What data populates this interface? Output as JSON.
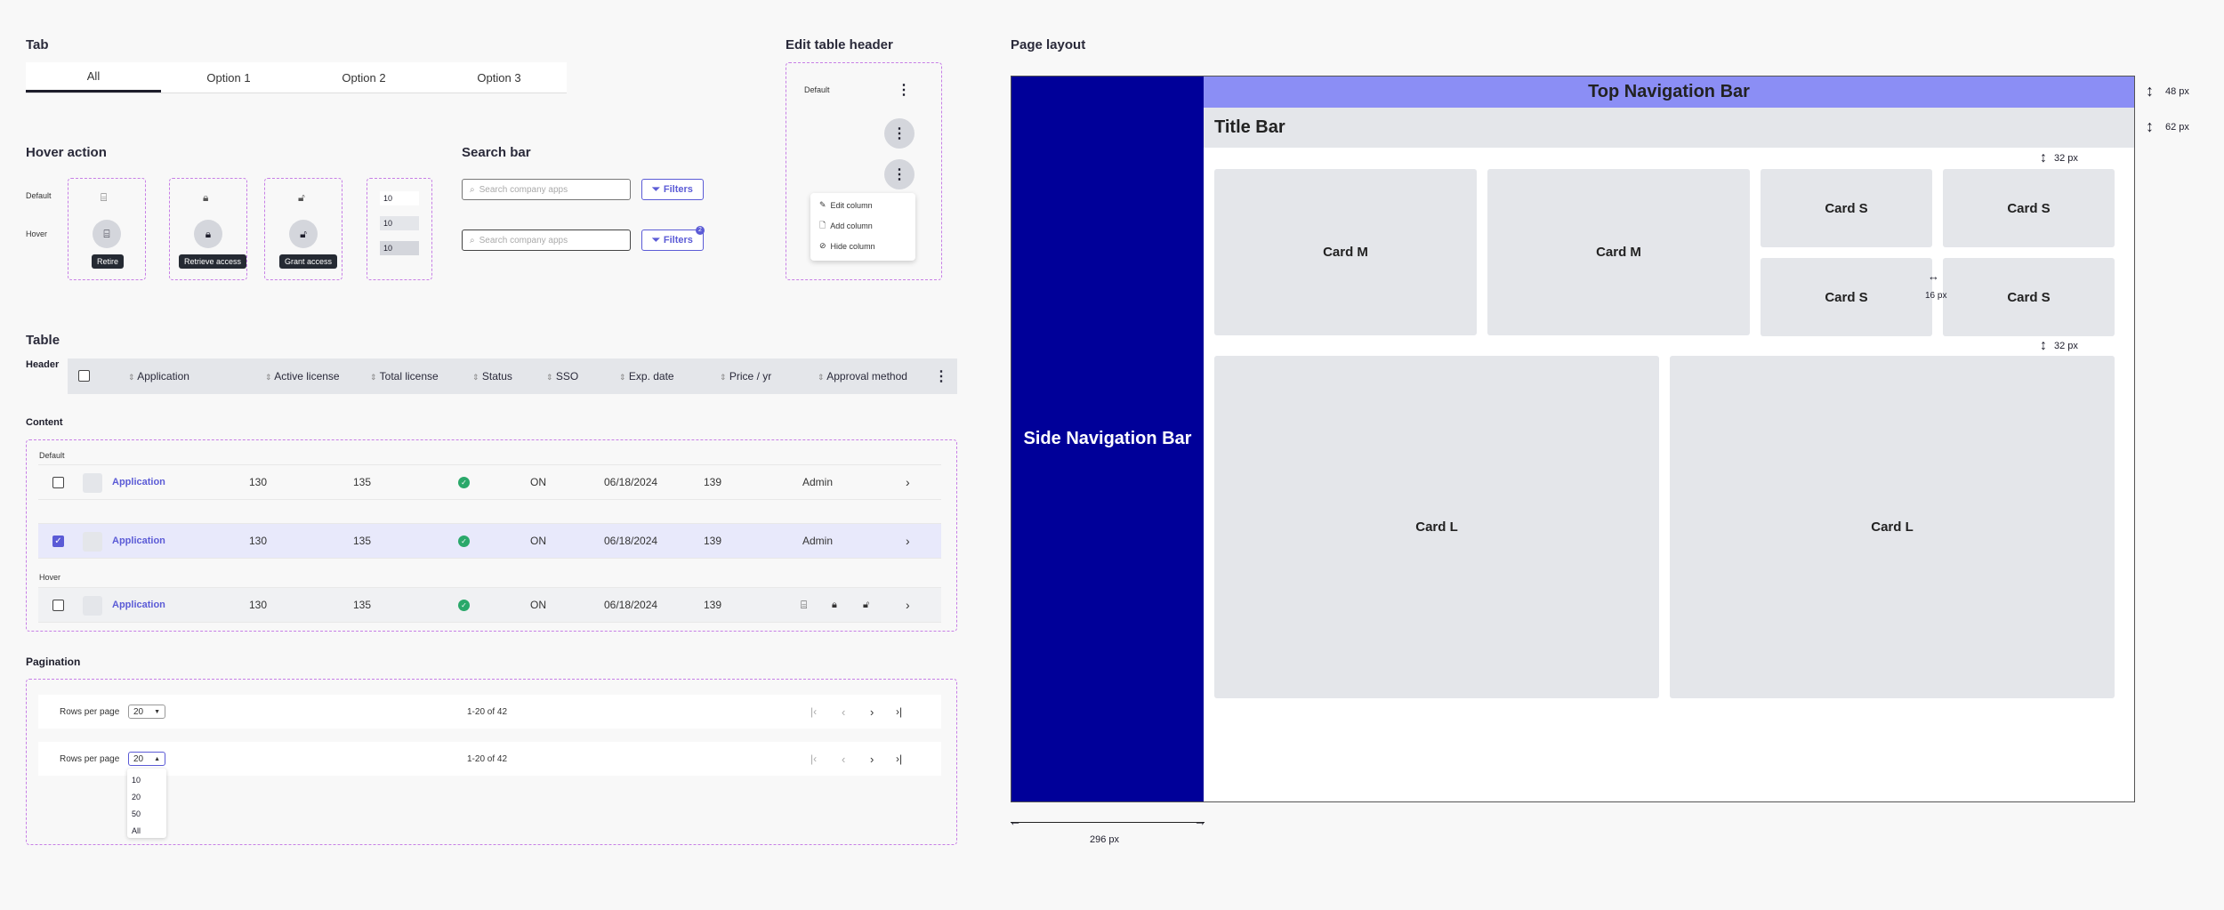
{
  "tab_section": {
    "title": "Tab",
    "tabs": [
      "All",
      "Option 1",
      "Option 2",
      "Option 3"
    ]
  },
  "hover_section": {
    "title": "Hover action",
    "default_label": "Default",
    "hover_label": "Hover",
    "tooltips": [
      "Retire",
      "Retrieve access",
      "Grant access"
    ],
    "stepper_values": [
      "10",
      "10",
      "10"
    ]
  },
  "search_section": {
    "title": "Search bar",
    "placeholder": "Search company apps",
    "filters_label": "Filters",
    "filters_badge": "2"
  },
  "edit_header": {
    "title": "Edit table header",
    "default_label": "Default",
    "menu": [
      "Edit column",
      "Add column",
      "Hide column"
    ]
  },
  "table": {
    "title": "Table",
    "header_label": "Header",
    "columns": [
      "Application",
      "Active license",
      "Total license",
      "Status",
      "SSO",
      "Exp. date",
      "Price / yr",
      "Approval method"
    ],
    "content_label": "Content",
    "default_label": "Default",
    "hover_label": "Hover",
    "rows": [
      {
        "app": "Application",
        "active": "130",
        "total": "135",
        "sso": "ON",
        "exp": "06/18/2024",
        "price": "139",
        "approval": "Admin"
      },
      {
        "app": "Application",
        "active": "130",
        "total": "135",
        "sso": "ON",
        "exp": "06/18/2024",
        "price": "139",
        "approval": "Admin"
      },
      {
        "app": "Application",
        "active": "130",
        "total": "135",
        "sso": "ON",
        "exp": "06/18/2024",
        "price": "139"
      }
    ]
  },
  "pagination": {
    "title": "Pagination",
    "rows_per_page": "Rows per page",
    "value": "20",
    "range": "1-20 of 42",
    "options": [
      "10",
      "20",
      "50",
      "All"
    ]
  },
  "page_layout": {
    "title": "Page layout",
    "top_nav": "Top Navigation Bar",
    "title_bar": "Title Bar",
    "side_nav": "Side Navigation Bar",
    "card_m": "Card M",
    "card_s": "Card S",
    "card_l": "Card L",
    "dim_48": "48 px",
    "dim_62": "62 px",
    "dim_32": "32 px",
    "dim_16": "16 px",
    "dim_296": "296 px"
  },
  "colors": {
    "accent": "#5b5bd6",
    "side_nav": "#000099",
    "top_nav": "#8b8ef5",
    "success": "#2aa86a"
  }
}
